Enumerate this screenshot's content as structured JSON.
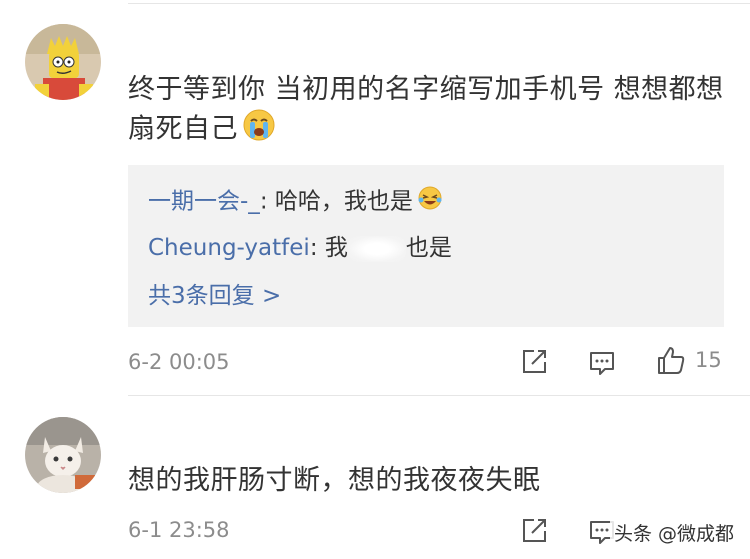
{
  "comments": [
    {
      "text": "终于等到你 当初用的名字缩写加手机号 想想都想扇死自己",
      "emoji": "crying-face-icon",
      "replies": [
        {
          "user": "一期一会-_",
          "separator": ":",
          "text": " 哈哈，我也是",
          "emoji": "laughing-tears-icon"
        },
        {
          "user": "Cheung-yatfei",
          "separator": ":",
          "text_before": " 我",
          "text_after": "也是"
        }
      ],
      "more_replies": "共3条回复 >",
      "time": "6-2 00:05",
      "likes": "15"
    },
    {
      "text": "想的我肝肠寸断，想的我夜夜失眠",
      "time": "6-1 23:58"
    }
  ],
  "watermark": "头条 @微成都",
  "colors": {
    "username_blue": "#4a6ea9",
    "meta_gray": "#8c8c8c",
    "reply_bg": "#f2f2f2"
  }
}
